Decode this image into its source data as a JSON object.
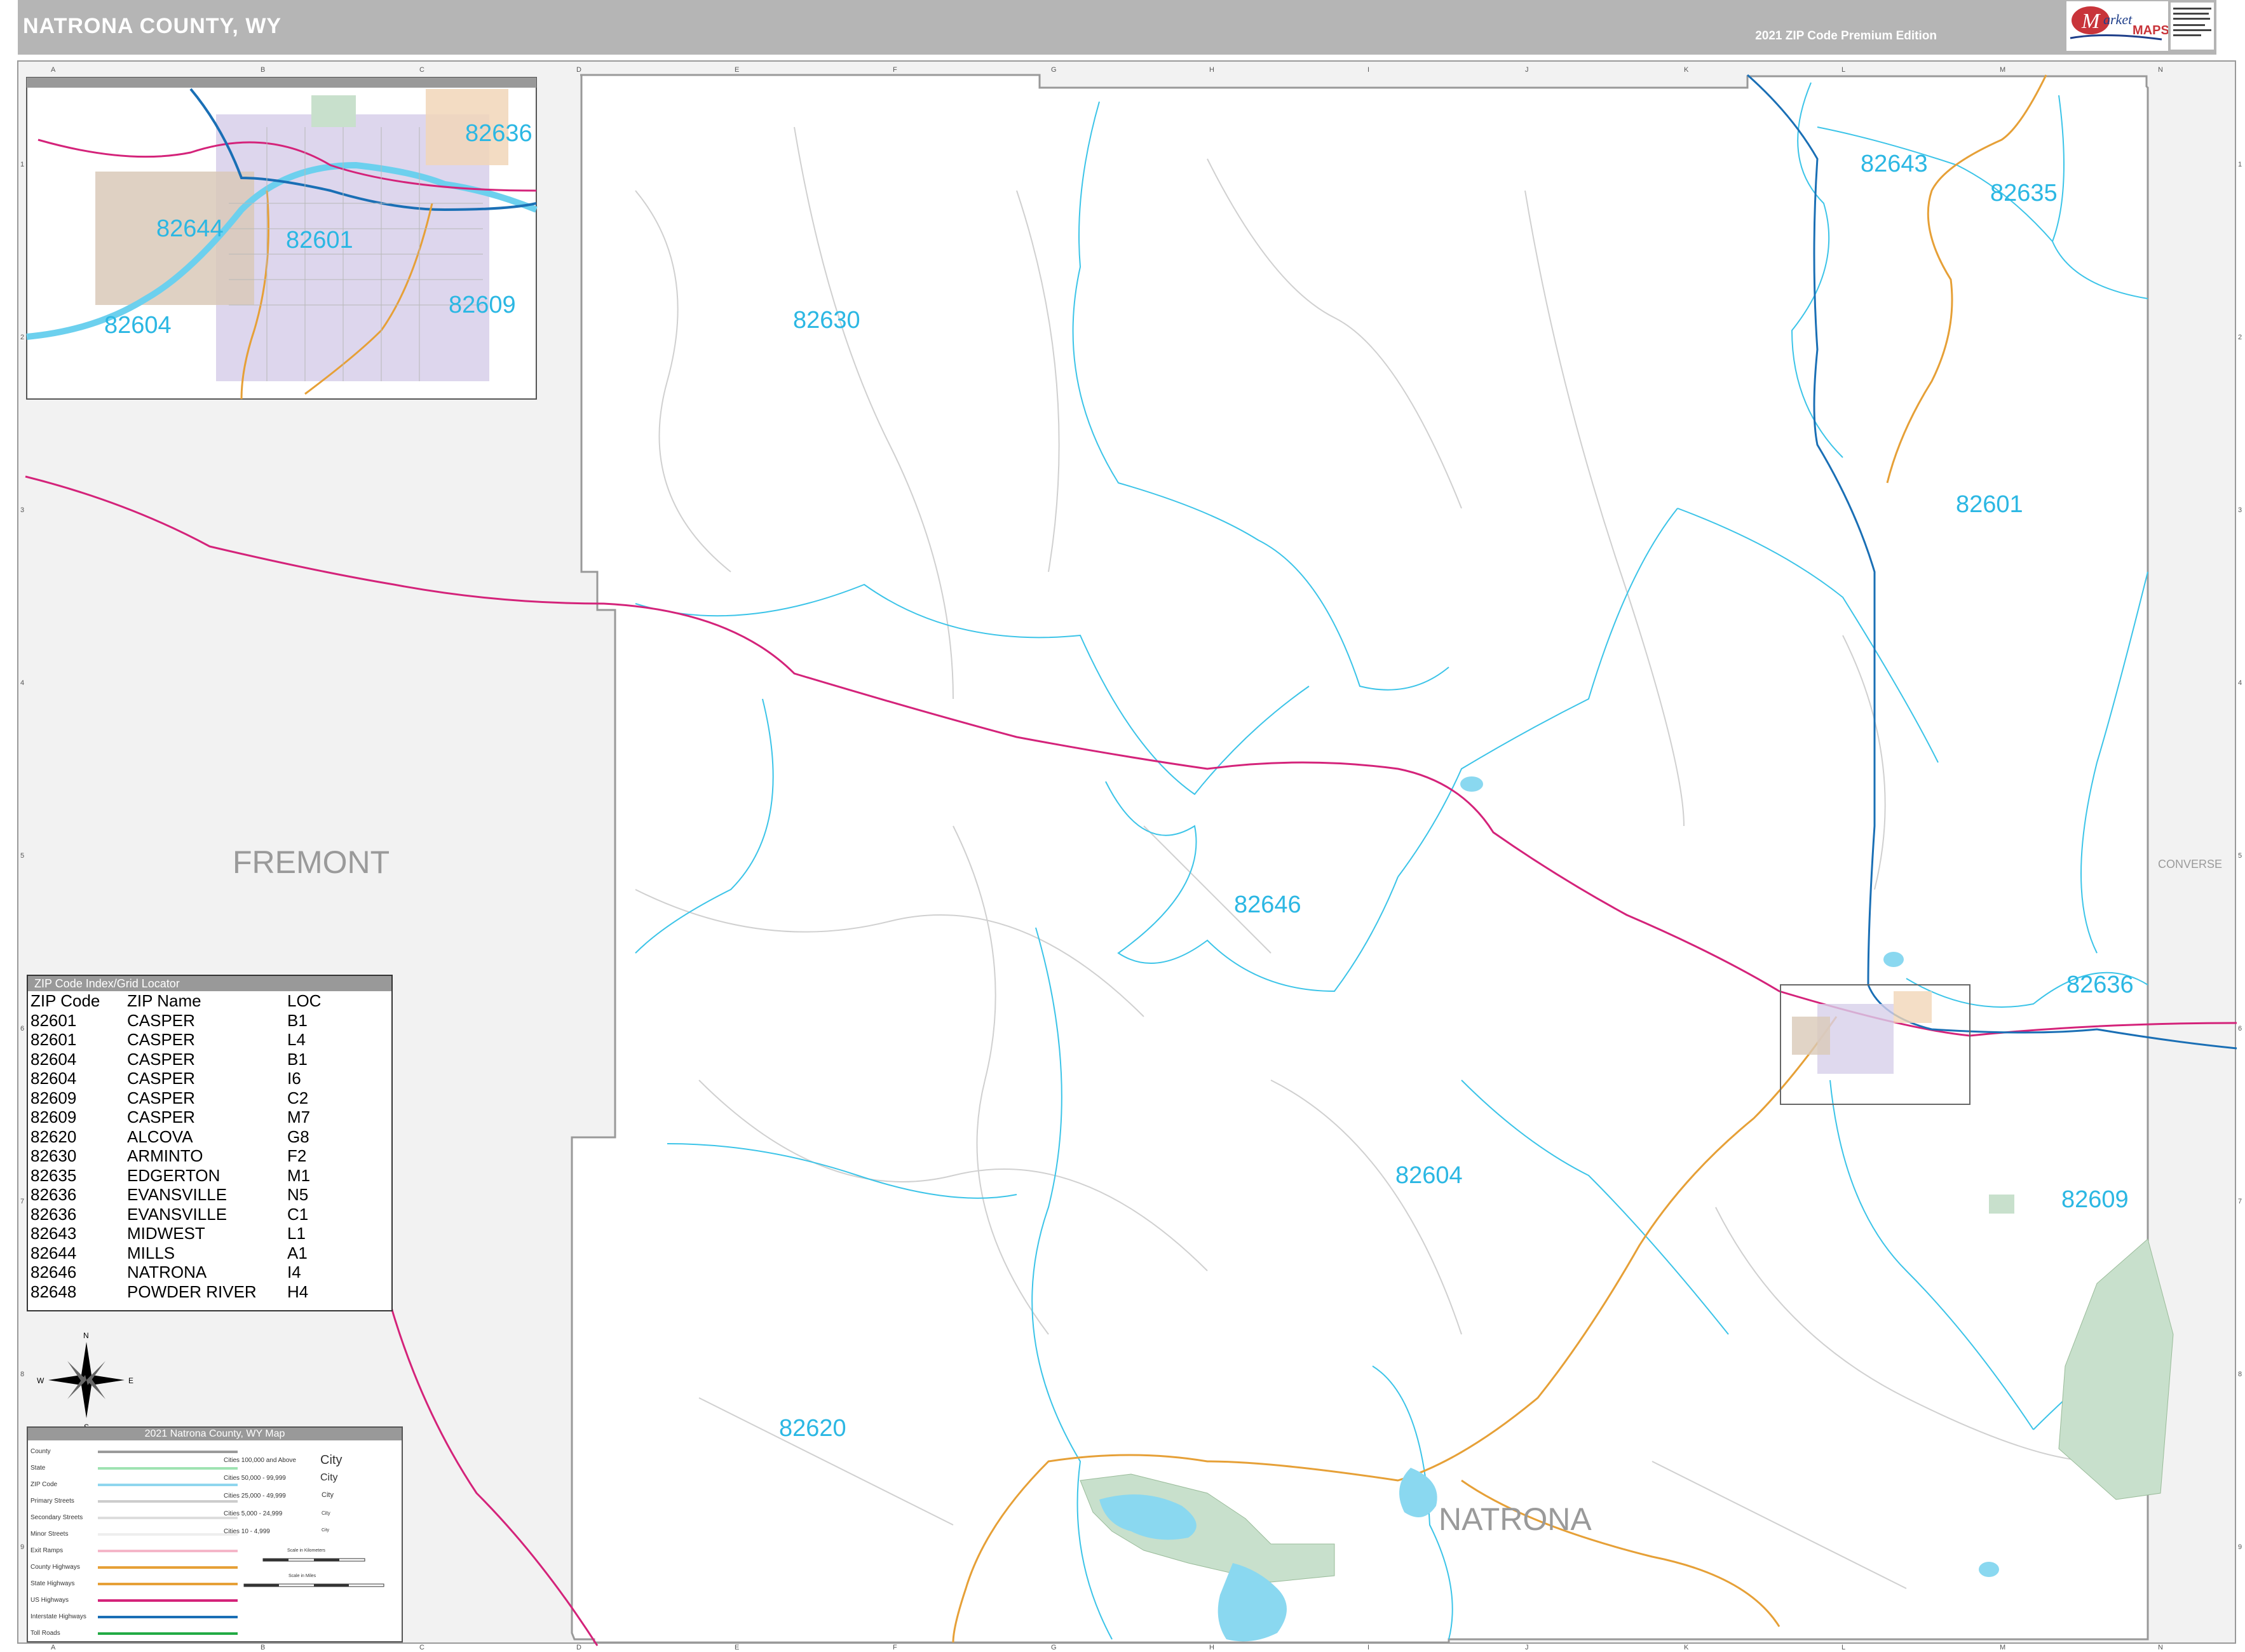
{
  "header": {
    "title": "NATRONA COUNTY, WY",
    "edition": "2021 ZIP Code Premium Edition",
    "logo_brand": "Market MAPS"
  },
  "counties": {
    "west": "FREMONT",
    "east": "CONVERSE",
    "natrona_label": "NATRONA"
  },
  "zip_labels": [
    "82630",
    "82643",
    "82635",
    "82601",
    "82646",
    "82636",
    "82604",
    "82609",
    "82620"
  ],
  "inset_zip_labels": [
    "82636",
    "82644",
    "82601",
    "82609",
    "82604"
  ],
  "grid": {
    "columns": [
      "A",
      "B",
      "C",
      "D",
      "E",
      "F",
      "G",
      "H",
      "I",
      "J",
      "K",
      "L",
      "M",
      "N"
    ],
    "rows": [
      "1",
      "2",
      "3",
      "4",
      "5",
      "6",
      "7",
      "8",
      "9"
    ]
  },
  "zip_index": {
    "title": "ZIP Code Index/Grid Locator",
    "headers": [
      "ZIP Code",
      "ZIP Name",
      "LOC"
    ],
    "rows": [
      [
        "82601",
        "CASPER",
        "B1"
      ],
      [
        "82601",
        "CASPER",
        "L4"
      ],
      [
        "82604",
        "CASPER",
        "B1"
      ],
      [
        "82604",
        "CASPER",
        "I6"
      ],
      [
        "82609",
        "CASPER",
        "C2"
      ],
      [
        "82609",
        "CASPER",
        "M7"
      ],
      [
        "82620",
        "ALCOVA",
        "G8"
      ],
      [
        "82630",
        "ARMINTO",
        "F2"
      ],
      [
        "82635",
        "EDGERTON",
        "M1"
      ],
      [
        "82636",
        "EVANSVILLE",
        "N5"
      ],
      [
        "82636",
        "EVANSVILLE",
        "C1"
      ],
      [
        "82643",
        "MIDWEST",
        "L1"
      ],
      [
        "82644",
        "MILLS",
        "A1"
      ],
      [
        "82646",
        "NATRONA",
        "I4"
      ],
      [
        "82648",
        "POWDER RIVER",
        "H4"
      ]
    ]
  },
  "legend": {
    "title": "2021 Natrona County, WY Map",
    "items": [
      "County",
      "State",
      "ZIP Code",
      "Primary Streets",
      "Secondary Streets",
      "Minor Streets",
      "Exit Ramps",
      "County Highways",
      "State Highways",
      "US Highways",
      "Interstate Highways",
      "Toll Roads"
    ],
    "cities": [
      "Cities 100,000 and Above",
      "Cities 50,000 - 99,999",
      "Cities 25,000 - 49,999",
      "Cities 5,000 - 24,999",
      "Cities 10 - 4,999"
    ],
    "city_samples": [
      "City",
      "City",
      "City",
      "City",
      "City"
    ],
    "scale_km": "Scale in Kilometers",
    "scale_mi": "Scale in Miles"
  },
  "compass": {
    "n": "N",
    "s": "S",
    "e": "E",
    "w": "W"
  },
  "colors": {
    "zip_boundary": "#3cc4e8",
    "us_highway": "#d4237a",
    "interstate": "#1a6fb5",
    "state_highway": "#e6a037",
    "water": "#8ad8f0",
    "park": "#c8e0cc",
    "outside_county": "#f2f2f2"
  }
}
